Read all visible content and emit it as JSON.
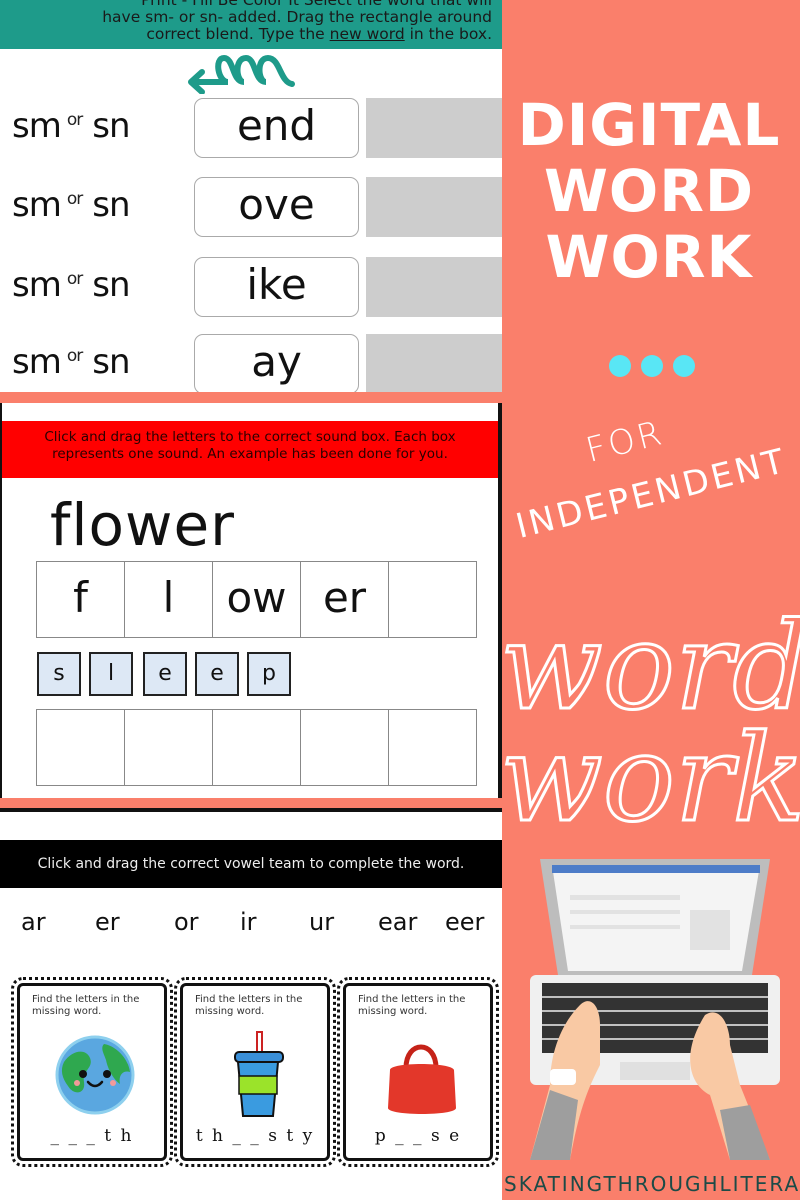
{
  "colors": {
    "background": "#fa7f6b",
    "panel1_header": "#1e9b8a",
    "panel2_header": "#ff0000",
    "panel3_header": "#000000",
    "tile_fill": "#dde8f5",
    "answer_box": "#cdcdcd",
    "dots": "#59e6f5"
  },
  "panel1": {
    "instructions": {
      "line0": "Print - Fill Be Color It  Select the word that will",
      "line1": "have sm- or sn- added. Drag the rectangle around",
      "line2_pre": "correct blend. Type the ",
      "line2_u": "new word",
      "line2_post": " in the box."
    },
    "arrow_icon": "curly-arrow-left-icon",
    "rows": [
      {
        "option_a": "sm",
        "or": "or",
        "option_b": "sn",
        "word": "end",
        "answer": ""
      },
      {
        "option_a": "sm",
        "or": "or",
        "option_b": "sn",
        "word": "ove",
        "answer": ""
      },
      {
        "option_a": "sm",
        "or": "or",
        "option_b": "sn",
        "word": "ike",
        "answer": ""
      },
      {
        "option_a": "sm",
        "or": "or",
        "option_b": "sn",
        "word": "ay",
        "answer": ""
      }
    ]
  },
  "panel2": {
    "instructions": {
      "line1": "Click and drag the letters to the correct sound box. Each box",
      "line2": "represents one sound. An example has been done for you."
    },
    "example_word": "flower",
    "example_sounds": [
      "f",
      "l",
      "ow",
      "er",
      ""
    ],
    "tiles": [
      "s",
      "l",
      "e",
      "e",
      "p"
    ],
    "answer_sounds": [
      "",
      "",
      "",
      "",
      ""
    ]
  },
  "panel3": {
    "instructions": "Click and drag the correct vowel team to complete the word.",
    "vowel_teams": [
      "ar",
      "er",
      "or",
      "ir",
      "ur",
      "ear",
      "eer"
    ],
    "cards": [
      {
        "instruction": "Find the letters in the missing word.",
        "picture": "earth-icon",
        "answer": "_ _ _ t h"
      },
      {
        "instruction": "Find the letters in the missing word.",
        "picture": "cup-with-straw-icon",
        "answer": "t h _ _ s t y"
      },
      {
        "instruction": "Find the letters in the missing word.",
        "picture": "purse-icon",
        "answer": "p _ _ s e"
      }
    ]
  },
  "right": {
    "title_lines": [
      "DIGITAL",
      "WORD",
      "WORK"
    ],
    "tag_line1": "FOR",
    "tag_line2": "INDEPENDENT",
    "script_line1": "word",
    "script_line2": "work",
    "illustration": "laptop-typing-hands-icon",
    "brand": "SKATINGTHROUGHLITERACY"
  }
}
